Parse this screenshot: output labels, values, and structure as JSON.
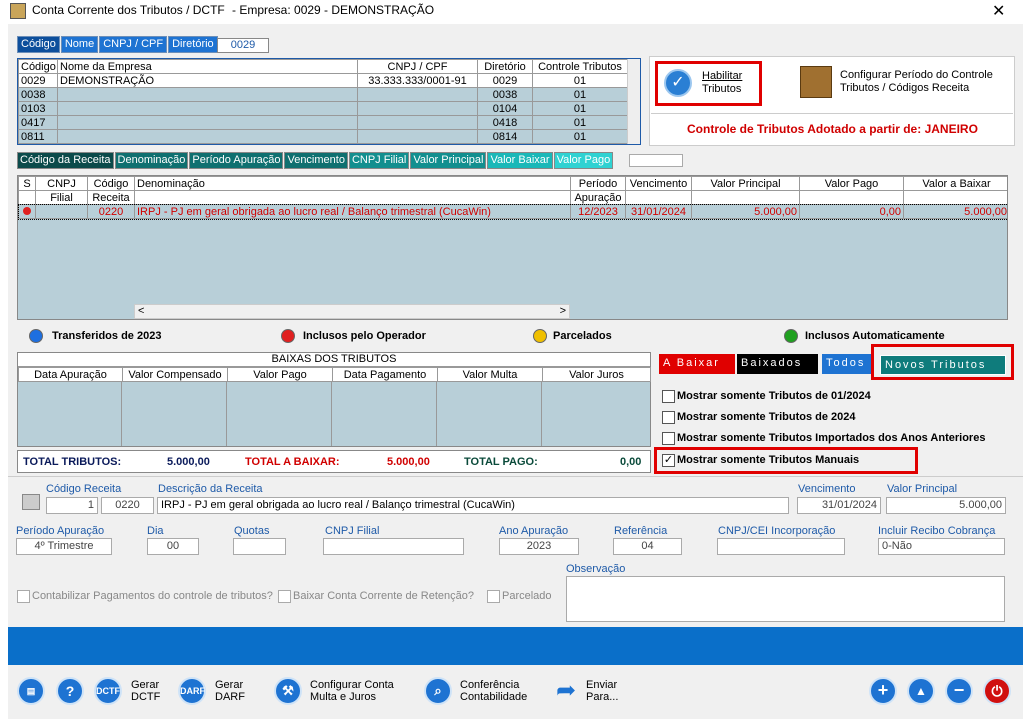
{
  "window": {
    "title": "Conta Corrente dos Tributos / DCTF",
    "empresa": "-   Empresa: 0029 - DEMONSTRAÇÃO",
    "close": "✕"
  },
  "top_tabs": [
    "Código",
    "Nome",
    "CNPJ / CPF",
    "Diretório"
  ],
  "search_value": "0029",
  "company_table": {
    "headers": [
      "Código",
      "Nome da Empresa",
      "CNPJ / CPF",
      "Diretório",
      "Controle Tributos"
    ],
    "rows": [
      [
        "0029",
        "DEMONSTRAÇÃO",
        "33.333.333/0001-91",
        "0029",
        "01"
      ],
      [
        "0038",
        "",
        "",
        "0038",
        "01"
      ],
      [
        "0103",
        "",
        "",
        "0104",
        "01"
      ],
      [
        "0417",
        "",
        "",
        "0418",
        "01"
      ],
      [
        "0811",
        "",
        "",
        "0814",
        "01"
      ]
    ]
  },
  "habilitar": {
    "line1": "Habilitar",
    "line2": "Tributos"
  },
  "configurar": {
    "line1": "Configurar Período do Controle",
    "line2": "Tributos / Códigos Receita"
  },
  "controle_text": "Controle de Tributos Adotado a partir de: JANEIRO",
  "receita_tabs": [
    "Código da Receita",
    "Denominação",
    "Período Apuração",
    "Vencimento",
    "CNPJ Filial",
    "Valor Principal",
    "Valor Baixar",
    "Valor Pago"
  ],
  "tributos_table": {
    "headers1": [
      "S",
      "CNPJ",
      "Código",
      "Denominação",
      "Período",
      "Vencimento",
      "Valor Principal",
      "Valor Pago",
      "Valor a Baixar"
    ],
    "headers2": [
      "",
      "Filial",
      "Receita",
      "",
      "Apuração",
      "",
      "",
      "",
      ""
    ],
    "row": [
      "",
      "",
      "0220",
      "IRPJ - PJ em geral obrigada ao lucro real / Balanço trimestral (CucaWin)",
      "12/2023",
      "31/01/2024",
      "5.000,00",
      "0,00",
      "5.000,00"
    ]
  },
  "legend": {
    "blue": "Transferidos de 2023",
    "red": "Inclusos pelo Operador",
    "yellow": "Parcelados",
    "green": "Inclusos Automaticamente"
  },
  "baixas": {
    "title": "BAIXAS DOS TRIBUTOS",
    "headers": [
      "Data Apuração",
      "Valor Compensado",
      "Valor Pago",
      "Data Pagamento",
      "Valor Multa",
      "Valor Juros"
    ]
  },
  "totais": {
    "tributos_label": "TOTAL TRIBUTOS:",
    "tributos_value": "5.000,00",
    "baixar_label": "TOTAL A BAIXAR:",
    "baixar_value": "5.000,00",
    "pago_label": "TOTAL PAGO:",
    "pago_value": "0,00"
  },
  "filter_tabs": {
    "a_baixar": "A Baixar",
    "baixados": "Baixados",
    "todos": "Todos",
    "novos": "Novos Tributos"
  },
  "checks": [
    {
      "label": "Mostrar somente Tributos de 01/2024",
      "checked": false
    },
    {
      "label": "Mostrar somente Tributos de 2024",
      "checked": false
    },
    {
      "label": "Mostrar somente Tributos Importados dos Anos Anteriores",
      "checked": false
    },
    {
      "label": "Mostrar somente Tributos Manuais",
      "checked": true
    }
  ],
  "detail": {
    "codigo_label": "Código Receita",
    "codigo_seq": "1",
    "codigo_val": "0220",
    "desc_label": "Descrição da Receita",
    "desc_val": "IRPJ - PJ em geral obrigada ao lucro real / Balanço trimestral (CucaWin)",
    "venc_label": "Vencimento",
    "venc_val": "31/01/2024",
    "vp_label": "Valor Principal",
    "vp_val": "5.000,00",
    "periodo_label": "Período Apuração",
    "periodo_val": "4º Trimestre",
    "dia_label": "Dia",
    "dia_val": "00",
    "quotas_label": "Quotas",
    "cnpj_label": "CNPJ Filial",
    "ano_label": "Ano Apuração",
    "ano_val": "2023",
    "ref_label": "Referência",
    "ref_val": "04",
    "cei_label": "CNPJ/CEI Incorporação",
    "recibo_label": "Incluir Recibo Cobrança",
    "recibo_val": "0-Não",
    "contab_label": "Contabilizar Pagamentos do controle de tributos?",
    "baixar_label": "Baixar Conta Corrente de Retenção?",
    "parcelado_label": "Parcelado",
    "obs_label": "Observação"
  },
  "bottom": {
    "gerar_dctf": [
      "Gerar",
      "DCTF"
    ],
    "gerar_darf": [
      "Gerar",
      "DARF"
    ],
    "configurar": [
      "Configurar Conta",
      "Multa  e  Juros"
    ],
    "conferencia": [
      "Conferência",
      "Contabilidade"
    ],
    "enviar": [
      "Enviar",
      "Para..."
    ],
    "dctf_icon": "DCTF",
    "darf_icon": "DARF"
  },
  "colors": {
    "accent": "#1e73d2",
    "red": "#e00000",
    "teal": "#0f8a8a"
  }
}
